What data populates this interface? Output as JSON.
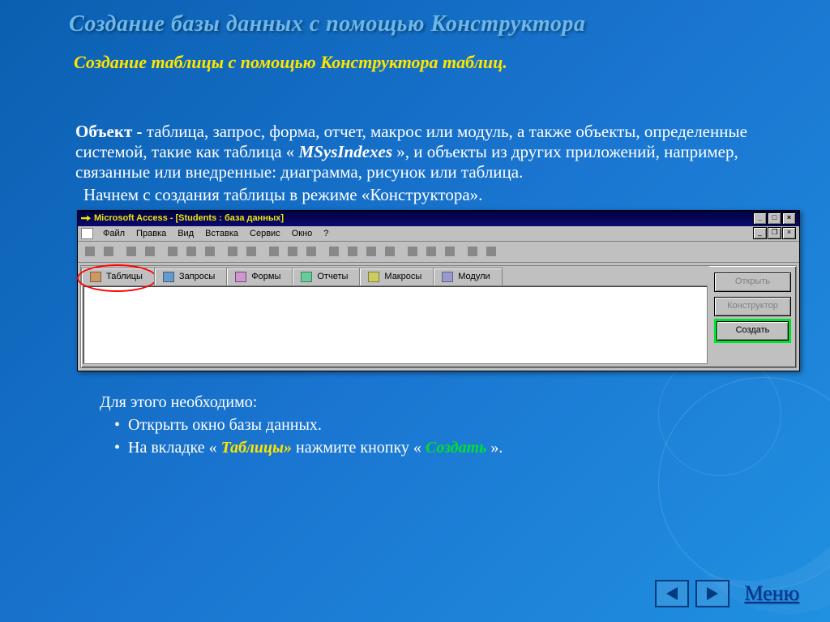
{
  "slide": {
    "title": "Создание базы данных с помощью Конструктора",
    "subtitle": "Создание таблицы с помощью Конструктора таблиц.",
    "paragraph_prefix": "Объект - ",
    "paragraph_body": "таблица, запрос, форма, отчет, макрос или модуль, а также объекты, определенные системой, такие как таблица « ",
    "paragraph_emph": "MSysIndexes",
    "paragraph_tail": " », и объекты из других приложений, например, связанные или внедренные: диаграмма, рисунок или таблица.",
    "paragraph2": "Начнем с создания таблицы в режиме «Конструктора».",
    "instructions_lead": "Для этого необходимо:",
    "bullet1": "Открыть окно базы данных.",
    "bullet2_a": "На вкладке « ",
    "bullet2_b": "Таблицы»",
    "bullet2_c": " нажмите кнопку  « ",
    "bullet2_d": "Создать",
    "bullet2_e": " »."
  },
  "app": {
    "title": "Microsoft Access - [Students : база данных]",
    "menus": [
      "Файл",
      "Правка",
      "Вид",
      "Вставка",
      "Сервис",
      "Окно",
      "?"
    ],
    "tabs": [
      "Таблицы",
      "Запросы",
      "Формы",
      "Отчеты",
      "Макросы",
      "Модули"
    ],
    "buttons": {
      "open": "Открыть",
      "design": "Конструктор",
      "create": "Создать"
    }
  },
  "footer": {
    "menu": "Меню"
  }
}
